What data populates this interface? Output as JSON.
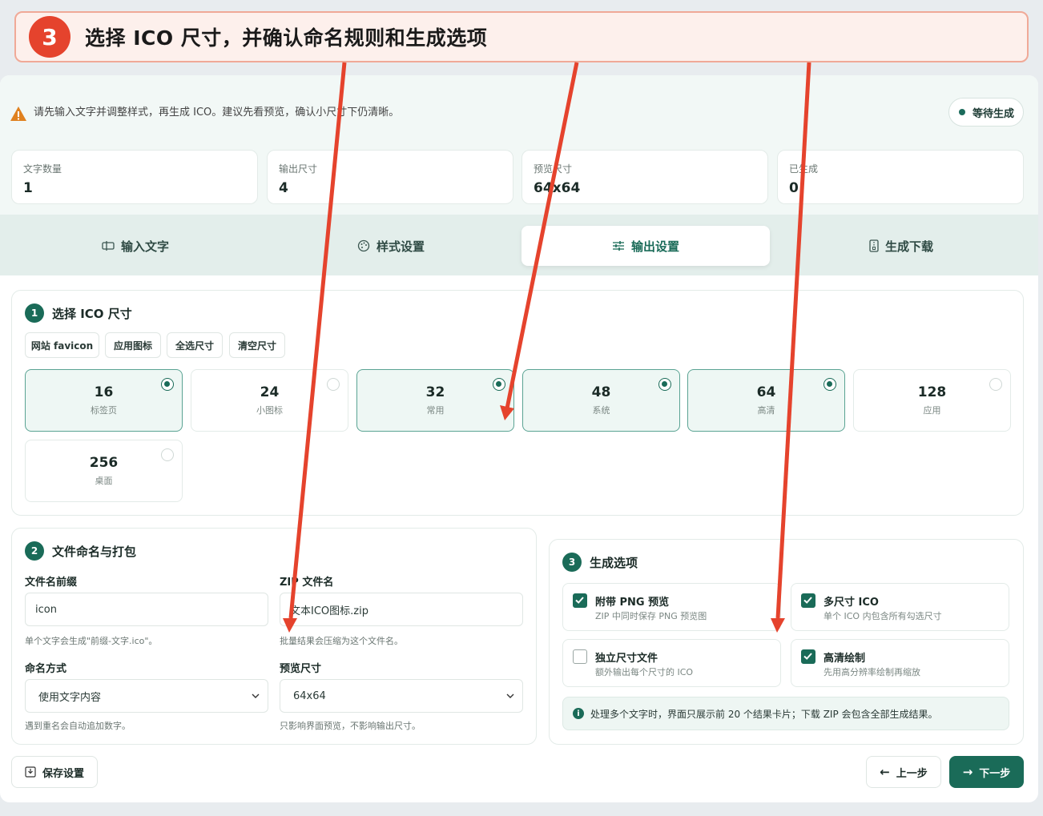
{
  "banner": {
    "step": "3",
    "title": "选择 ICO 尺寸，并确认命名规则和生成选项"
  },
  "notice": {
    "text": "请先输入文字并调整样式，再生成 ICO。建议先看预览，确认小尺寸下仍清晰。",
    "status": "等待生成"
  },
  "stats": [
    {
      "label": "文字数量",
      "value": "1"
    },
    {
      "label": "输出尺寸",
      "value": "4"
    },
    {
      "label": "预览尺寸",
      "value": "64x64"
    },
    {
      "label": "已生成",
      "value": "0"
    }
  ],
  "tabs": [
    {
      "label": "输入文字",
      "icon": "text-input-icon"
    },
    {
      "label": "样式设置",
      "icon": "palette-icon"
    },
    {
      "label": "输出设置",
      "icon": "sliders-icon",
      "active": true
    },
    {
      "label": "生成下载",
      "icon": "file-zip-icon"
    }
  ],
  "sizes_section": {
    "num": "1",
    "title": "选择 ICO 尺寸",
    "chips": [
      "网站 favicon",
      "应用图标",
      "全选尺寸",
      "清空尺寸"
    ],
    "sizes": [
      {
        "value": "16",
        "label": "标签页",
        "selected": true
      },
      {
        "value": "24",
        "label": "小图标",
        "selected": false
      },
      {
        "value": "32",
        "label": "常用",
        "selected": true
      },
      {
        "value": "48",
        "label": "系统",
        "selected": true
      },
      {
        "value": "64",
        "label": "高清",
        "selected": true
      },
      {
        "value": "128",
        "label": "应用",
        "selected": false
      },
      {
        "value": "256",
        "label": "桌面",
        "selected": false
      }
    ]
  },
  "naming_section": {
    "num": "2",
    "title": "文件命名与打包",
    "prefix_label": "文件名前缀",
    "prefix_value": "icon",
    "prefix_hint": "单个文字会生成\"前缀-文字.ico\"。",
    "zip_label": "ZIP 文件名",
    "zip_value": "文本ICO图标.zip",
    "zip_hint": "批量结果会压缩为这个文件名。",
    "mode_label": "命名方式",
    "mode_value": "使用文字内容",
    "mode_hint": "遇到重名会自动追加数字。",
    "preview_label": "预览尺寸",
    "preview_value": "64x64",
    "preview_hint": "只影响界面预览，不影响输出尺寸。"
  },
  "options_section": {
    "num": "3",
    "title": "生成选项",
    "options": [
      {
        "title": "附带 PNG 预览",
        "sub": "ZIP 中同时保存 PNG 预览图",
        "checked": true
      },
      {
        "title": "多尺寸 ICO",
        "sub": "单个 ICO 内包含所有勾选尺寸",
        "checked": true
      },
      {
        "title": "独立尺寸文件",
        "sub": "额外输出每个尺寸的 ICO",
        "checked": false
      },
      {
        "title": "高清绘制",
        "sub": "先用高分辨率绘制再缩放",
        "checked": true
      }
    ],
    "info": "处理多个文字时，界面只展示前 20 个结果卡片；下载 ZIP 会包含全部生成结果。"
  },
  "footer": {
    "save": "保存设置",
    "prev": "上一步",
    "next": "下一步"
  },
  "colors": {
    "accent": "#1a6b58",
    "annotation": "#e5432d"
  }
}
